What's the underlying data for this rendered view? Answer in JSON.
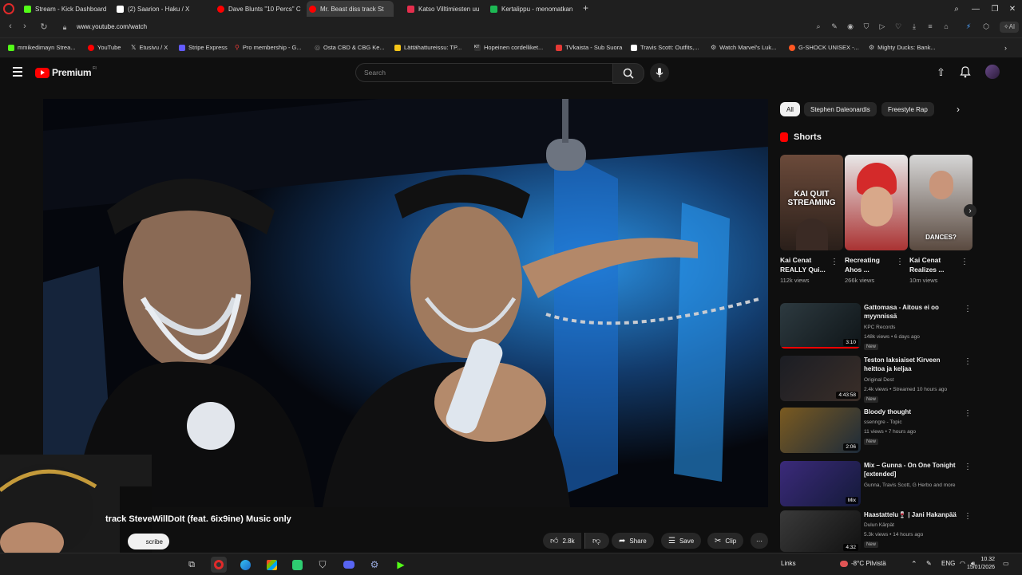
{
  "tabs": [
    {
      "label": "Stream - Kick Dashboard",
      "color": "#53fc18"
    },
    {
      "label": "(2) Saarion - Haku / X",
      "color": "#ffffff"
    },
    {
      "label": "Dave Blunts \"10 Percs\" C",
      "color": "#ff0000"
    },
    {
      "label": "Mr. Beast diss track St",
      "color": "#ff0000",
      "active": true
    },
    {
      "label": "Katso Villtimiesten uu",
      "color": "#e52e4d"
    },
    {
      "label": "Kertalippu - menomatkan",
      "color": "#1db954"
    }
  ],
  "address": {
    "url": "www.youtube.com/watch"
  },
  "bookmarks": [
    {
      "label": "mmikedimayn Strea...",
      "color": "#53fc18"
    },
    {
      "label": "YouTube",
      "color": "#ff0000"
    },
    {
      "label": "Etusivu / X",
      "color": "#ffffff"
    },
    {
      "label": "Stripe Express",
      "color": "#635bff"
    },
    {
      "label": "Pro membership - G...",
      "color": "#e53935"
    },
    {
      "label": "Osta CBD & CBG Ke...",
      "color": "#888888"
    },
    {
      "label": "Lättähattureissu: TP...",
      "color": "#f5c518"
    },
    {
      "label": "Hopeinen cordelliket...",
      "color": "#333333"
    },
    {
      "label": "TVkaista - Sub Suora",
      "color": "#e53935"
    },
    {
      "label": "Travis Scott: Outfits,...",
      "color": "#ffffff"
    },
    {
      "label": "Watch Marvel's Luk...",
      "color": "#cccccc"
    },
    {
      "label": "G-SHOCK UNISEX -...",
      "color": "#ff5722"
    },
    {
      "label": "Mighty Ducks: Bank...",
      "color": "#cccccc"
    }
  ],
  "youtube": {
    "logo": "Premium",
    "logo_region": "FI",
    "search_placeholder": "Search"
  },
  "video": {
    "title": "Mr. Beast diss track SteveWillDoIt (feat. 6ix9ine) Music only",
    "visible_title": "track SteveWillDoIt (feat. 6ix9ine) Music only",
    "subscribe_label": "scribe",
    "likes": "2.8k",
    "share_label": "Share",
    "save_label": "Save",
    "clip_label": "Clip"
  },
  "chips": [
    {
      "label": "All",
      "selected": true
    },
    {
      "label": "Stephen Daleonardis",
      "selected": false
    },
    {
      "label": "Freestyle Rap",
      "selected": false
    }
  ],
  "shorts": {
    "heading": "Shorts",
    "items": [
      {
        "title": "Kai Cenat REALLY Qui...",
        "views": "112k views",
        "overlay": "KAI QUIT STREAMING"
      },
      {
        "title": "Recreating Ahos ...",
        "views": "266k views",
        "overlay": ""
      },
      {
        "title": "Kai Cenat Realizes ...",
        "views": "10m views",
        "overlay": "DANCES?"
      }
    ]
  },
  "recommendations": [
    {
      "title": "Gattomasa - Aitous ei oo myynnissä",
      "channel": "KPC Records",
      "meta": "148k views • 6 days ago",
      "duration": "3:10",
      "new": "New"
    },
    {
      "title": "Teston laksiaiset Kirveen heittoa ja keljaa",
      "channel": "Original Dest",
      "meta": "2.4k views • Streamed 10 hours ago",
      "duration": "4:43:58",
      "new": "New"
    },
    {
      "title": "Bloody thought",
      "channel": "ssenngre - Topic",
      "meta": "11 views • 7 hours ago",
      "duration": "2:06",
      "new": "New"
    },
    {
      "title": "Mix – Gunna - On One Tonight [extended]",
      "channel": "Gunna, Travis Scott, G Herbo and more",
      "meta": "",
      "duration": "Mix",
      "new": ""
    },
    {
      "title": "Haastattelu🍷 | Jani Hakanpää",
      "channel": "Dulun Kärpät",
      "meta": "5.3k views • 14 hours ago",
      "duration": "4:32",
      "new": "New"
    }
  ],
  "taskbar": {
    "links_label": "Links",
    "weather": "-8°C Pilvistä",
    "language": "ENG",
    "time": "10.32",
    "date": "15/01/2026"
  },
  "colors": {
    "youtube_red": "#ff0000",
    "background": "#0f0f0f",
    "chrome": "#1f1f1f"
  }
}
